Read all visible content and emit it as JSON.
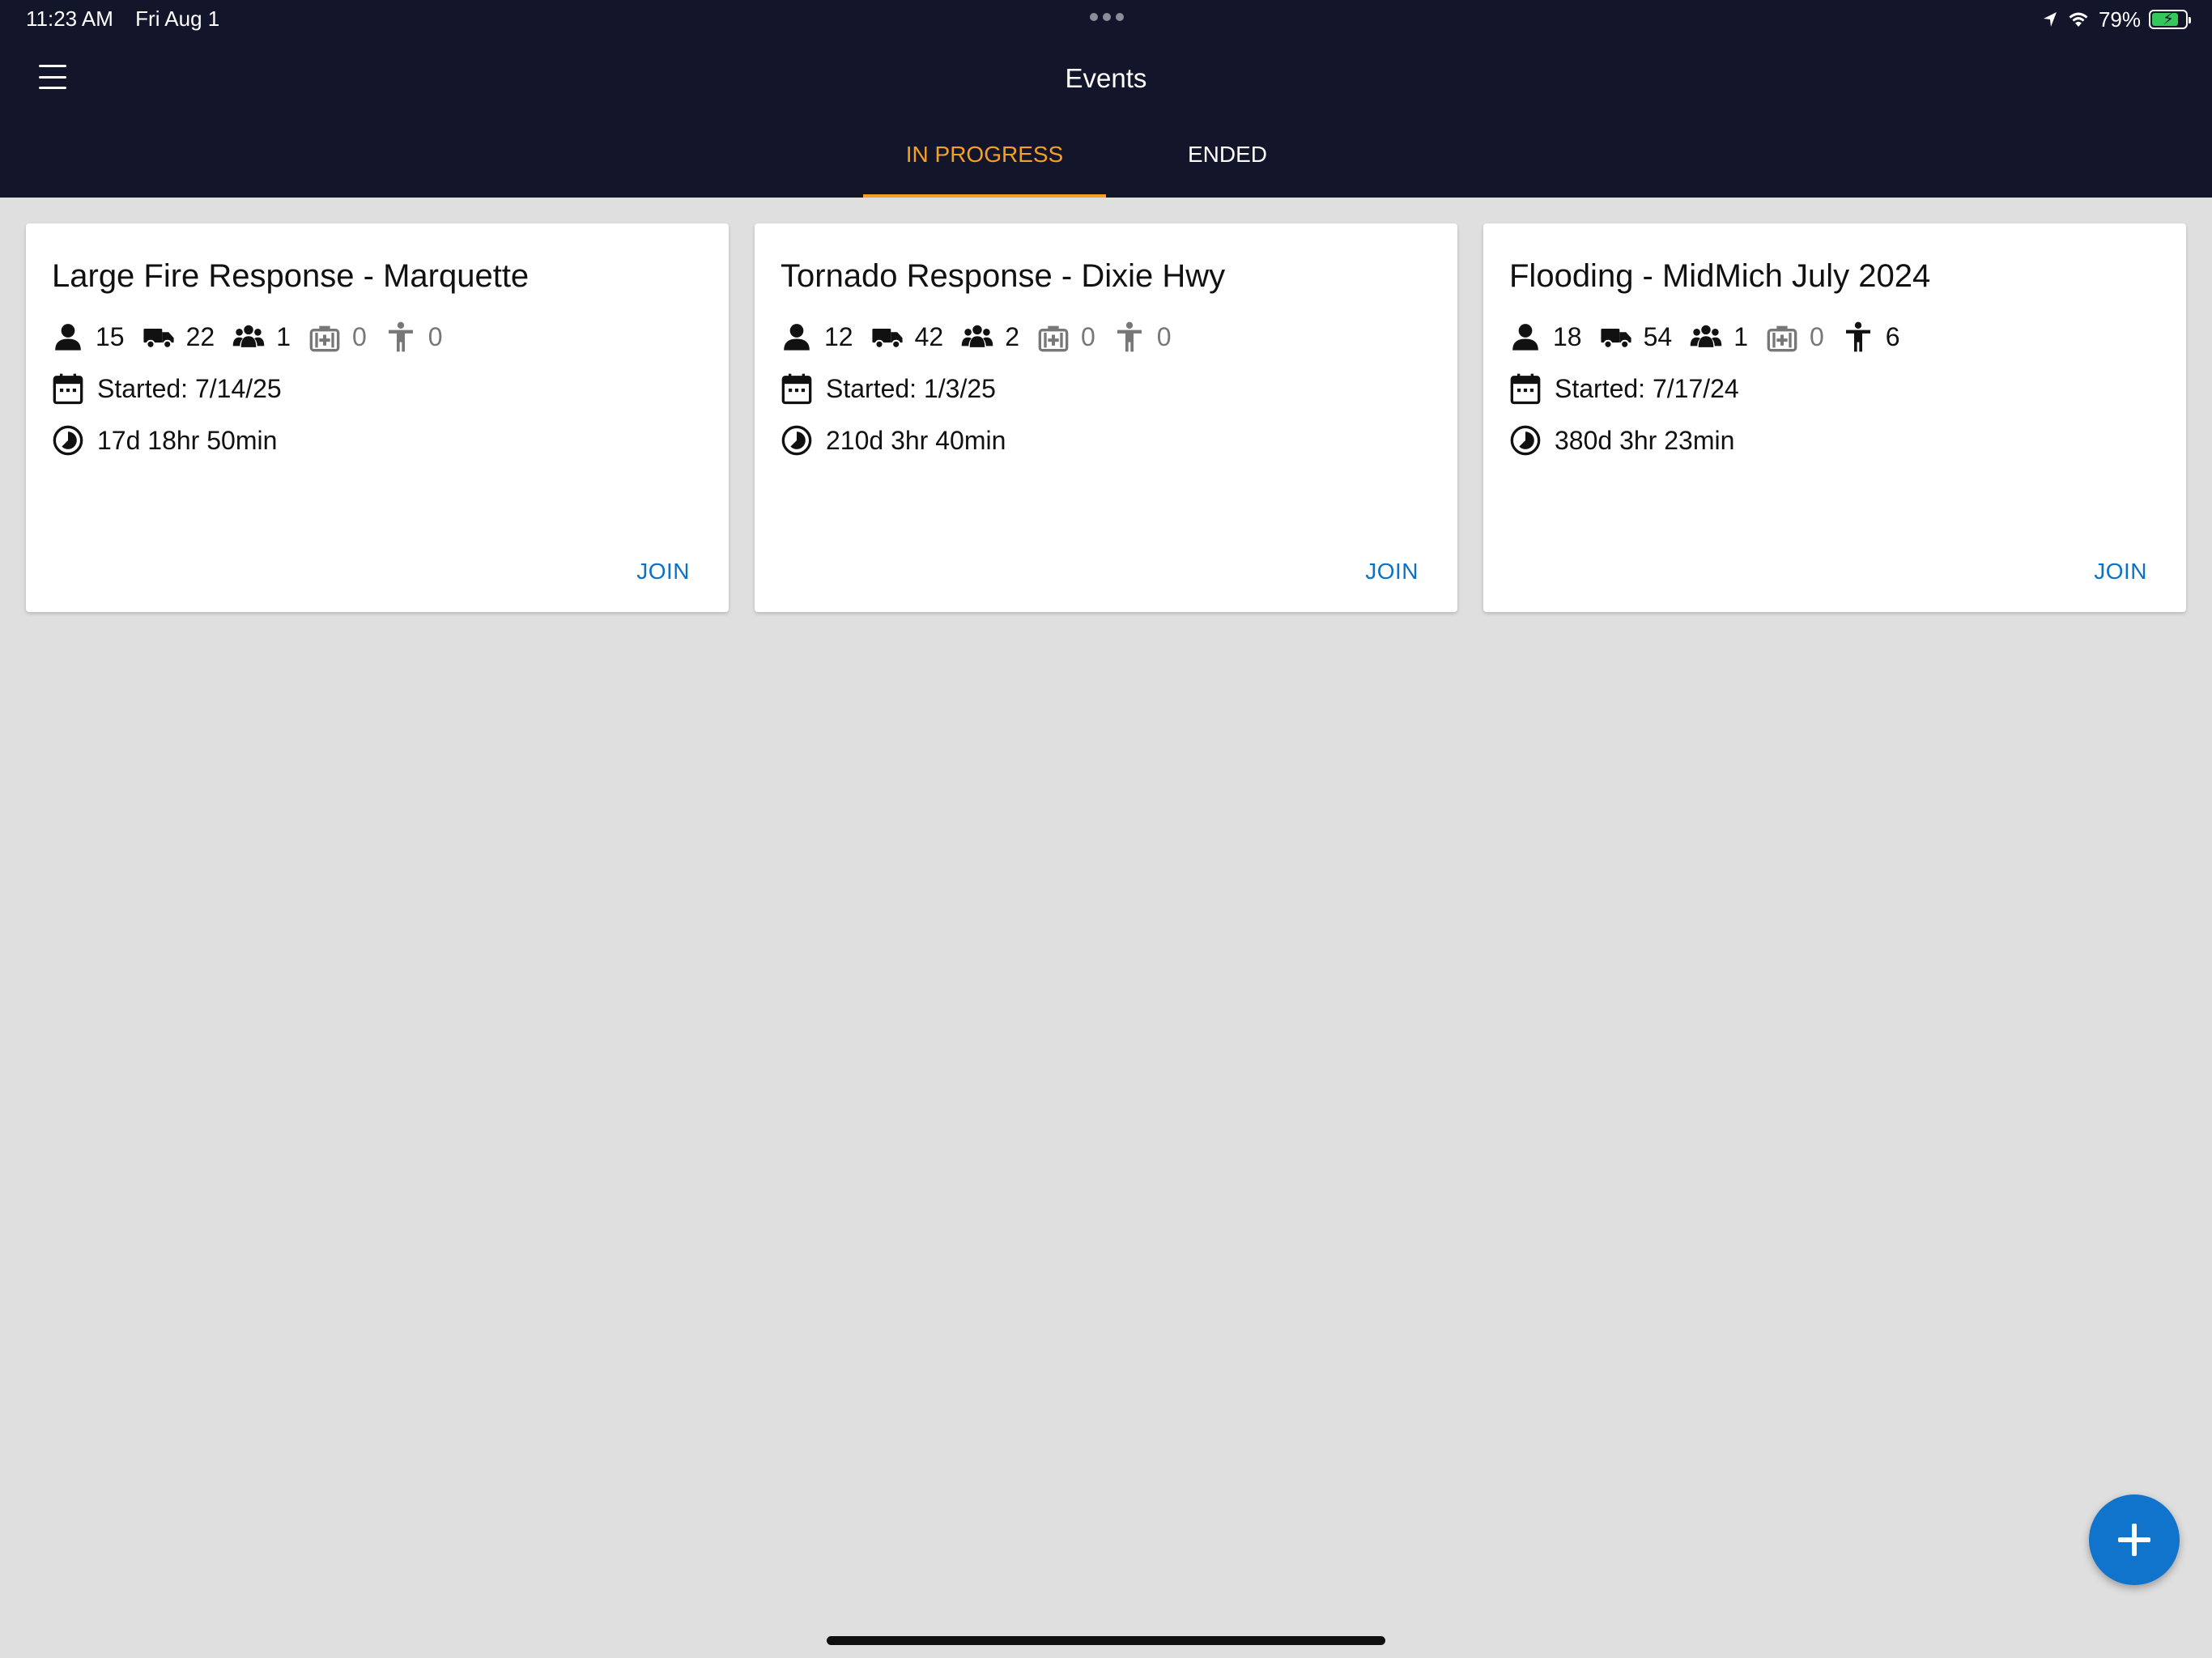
{
  "status_bar": {
    "time": "11:23 AM",
    "date": "Fri Aug 1",
    "battery_percent": "79%",
    "battery_level": 0.79,
    "icons": [
      "location-arrow-icon",
      "wifi-icon",
      "battery-charging-icon"
    ]
  },
  "header": {
    "title": "Events",
    "menu_icon": "hamburger-menu-icon",
    "tabs": [
      {
        "label": "IN PROGRESS",
        "active": true
      },
      {
        "label": "ENDED",
        "active": false
      }
    ],
    "background": "#13152a",
    "accent": "#f6a023"
  },
  "events": [
    {
      "title": "Large Fire Response - Marquette",
      "stats": {
        "personnel": "15",
        "vehicles": "22",
        "teams": "1",
        "medical": "0",
        "victims": "0"
      },
      "started": "Started: 7/14/25",
      "duration": "17d 18hr 50min",
      "action": "JOIN"
    },
    {
      "title": "Tornado Response - Dixie Hwy",
      "stats": {
        "personnel": "12",
        "vehicles": "42",
        "teams": "2",
        "medical": "0",
        "victims": "0"
      },
      "started": "Started: 1/3/25",
      "duration": "210d 3hr 40min",
      "action": "JOIN"
    },
    {
      "title": "Flooding - MidMich July 2024",
      "stats": {
        "personnel": "18",
        "vehicles": "54",
        "teams": "1",
        "medical": "0",
        "victims": "6"
      },
      "started": "Started: 7/17/24",
      "duration": "380d 3hr 23min",
      "action": "JOIN"
    }
  ],
  "stat_icons": {
    "personnel": "person-icon",
    "vehicles": "truck-icon",
    "teams": "group-icon",
    "medical": "medical-kit-icon",
    "victims": "accessibility-icon"
  },
  "fab": {
    "icon": "plus-icon",
    "color": "#1174cc"
  },
  "link_color": "#0a72c8"
}
